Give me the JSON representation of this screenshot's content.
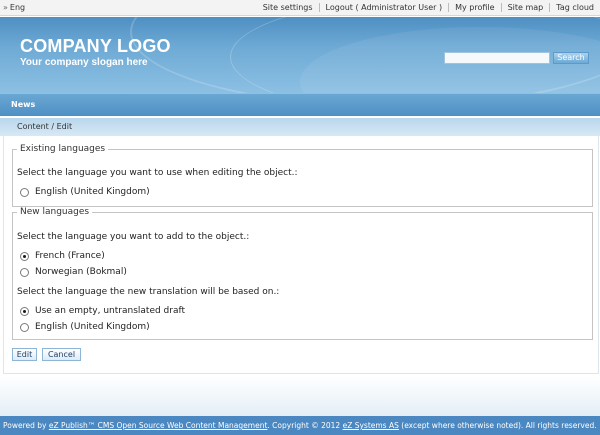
{
  "topbar": {
    "language": "Eng",
    "links": [
      "Site settings",
      "Logout ( Administrator User )",
      "My profile",
      "Site map",
      "Tag cloud"
    ]
  },
  "header": {
    "logo": "COMPANY LOGO",
    "slogan": "Your company slogan here",
    "search_value": "",
    "search_button": "Search"
  },
  "nav": {
    "item": "News"
  },
  "breadcrumb": "Content / Edit",
  "existing": {
    "legend": "Existing languages",
    "prompt": "Select the language you want to use when editing the object.:",
    "options": [
      {
        "label": "English (United Kingdom)",
        "selected": false
      }
    ]
  },
  "new_languages": {
    "legend": "New languages",
    "prompt": "Select the language you want to add to the object.:",
    "options": [
      {
        "label": "French (France)",
        "selected": true
      },
      {
        "label": "Norwegian (Bokmal)",
        "selected": false
      }
    ],
    "base_prompt": "Select the language the new translation will be based on.:",
    "base_options": [
      {
        "label": "Use an empty, untranslated draft",
        "selected": true
      },
      {
        "label": "English (United Kingdom)",
        "selected": false
      }
    ]
  },
  "actions": {
    "edit": "Edit",
    "cancel": "Cancel"
  },
  "footer": {
    "powered_by": "Powered by",
    "product_link": "eZ Publish™ CMS Open Source Web Content Management",
    "copyright": ". Copyright © 2012",
    "company_link": "eZ Systems AS",
    "rights": "(except where otherwise noted). All rights reserved."
  }
}
